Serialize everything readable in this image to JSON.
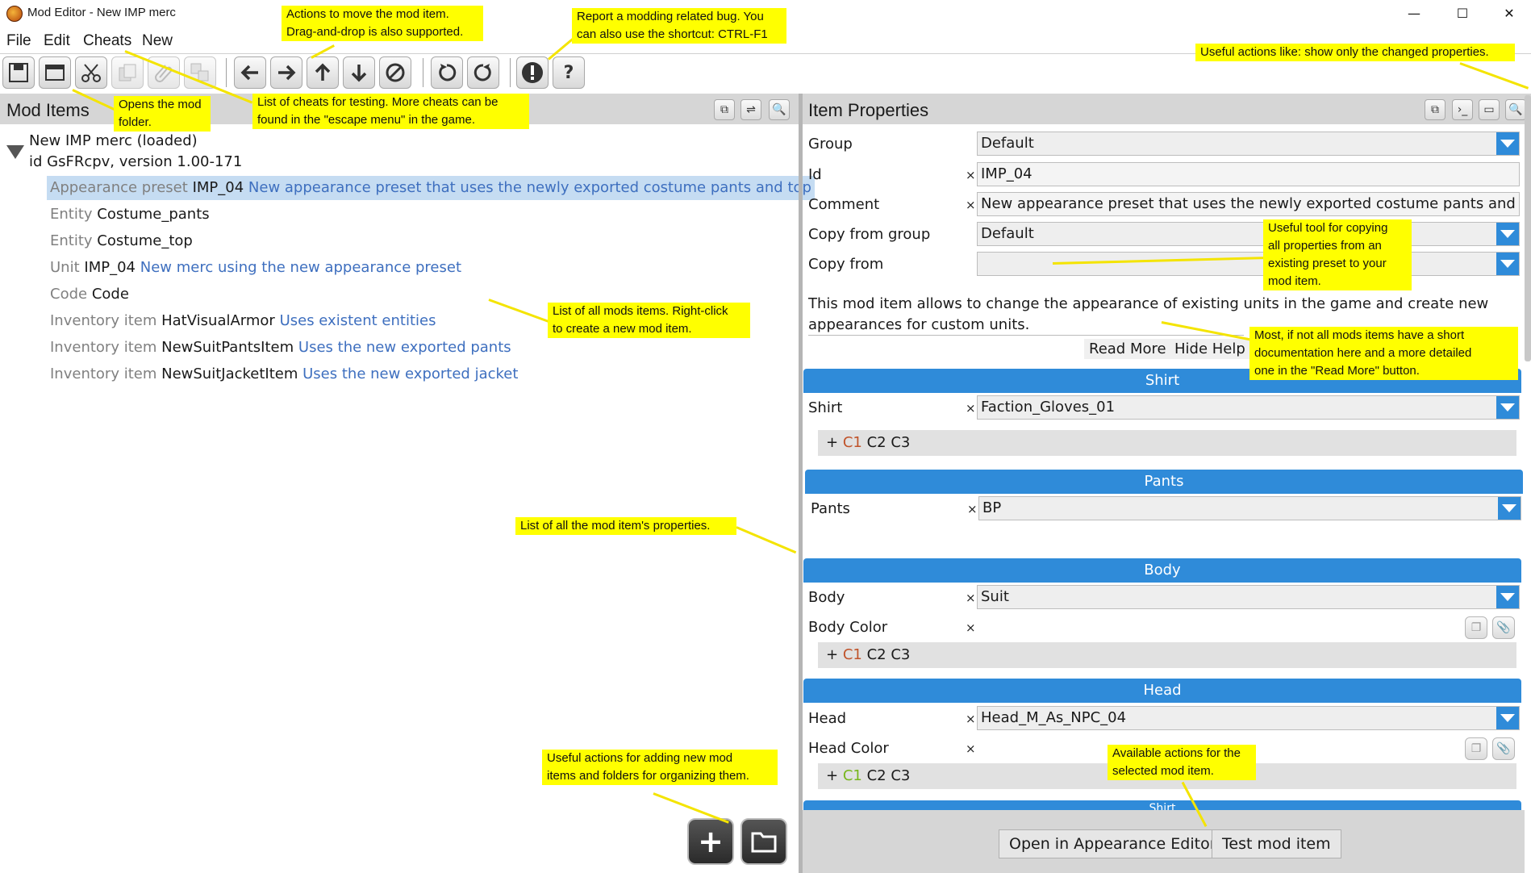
{
  "window": {
    "title": "Mod Editor - New IMP merc",
    "minimize_glyph": "—",
    "maximize_glyph": "☐",
    "close_glyph": "✕"
  },
  "menu": [
    "File",
    "Edit",
    "Cheats",
    "New"
  ],
  "toolbar": {
    "help_glyph": "?",
    "buttons": [
      "save-icon",
      "open-folder-icon",
      "cut-icon",
      "copy-icon",
      "paste-icon",
      "duplicate-icon",
      "arrow-left-icon",
      "arrow-right-icon",
      "arrow-up-icon",
      "arrow-down-icon",
      "cancel-icon",
      "undo-icon",
      "redo-icon",
      "report-bug-icon",
      "help-icon"
    ]
  },
  "left_panel": {
    "title": "Mod Items",
    "mod_name": "New IMP merc (loaded)",
    "mod_id": "id GsFRcpv, version 1.00-171",
    "items": [
      {
        "cls": "Appearance preset",
        "name": "IMP_04",
        "comment": "New appearance preset that uses the newly exported costume pants and top"
      },
      {
        "cls": "Entity",
        "name": "Costume_pants",
        "comment": ""
      },
      {
        "cls": "Entity",
        "name": "Costume_top",
        "comment": ""
      },
      {
        "cls": "Unit",
        "name": "IMP_04",
        "comment": "New merc using the new appearance preset"
      },
      {
        "cls": "Code",
        "name": "Code",
        "comment": ""
      },
      {
        "cls": "Inventory item",
        "name": "HatVisualArmor",
        "comment": "Uses existent entities"
      },
      {
        "cls": "Inventory item",
        "name": "NewSuitPantsItem",
        "comment": "Uses the new exported pants"
      },
      {
        "cls": "Inventory item",
        "name": "NewSuitJacketItem",
        "comment": "Uses the new exported jacket"
      }
    ]
  },
  "right_panel": {
    "title": "Item Properties",
    "clear_glyph": "×",
    "group_label": "Group",
    "group_value": "Default",
    "id_label": "Id",
    "id_value": "IMP_04",
    "comment_label": "Comment",
    "comment_value": "New appearance preset that uses the newly exported costume pants and top",
    "copy_group_label": "Copy from group",
    "copy_group_value": "Default",
    "copy_from_label": "Copy from",
    "copy_from_value": "",
    "help_line1": "This mod item allows to change the appearance of existing units in the game and create new",
    "help_line2": "appearances for custom units.",
    "read_more": "Read More",
    "hide_help": "Hide Help",
    "color_prefix": "+",
    "c1": "C1",
    "c2c3": "C2 C3",
    "sections": {
      "shirt_header": "Shirt",
      "shirt_label": "Shirt",
      "shirt_value": "Faction_Gloves_01",
      "pants_header": "Pants",
      "pants_label": "Pants",
      "pants_value": "BP",
      "body_header": "Body",
      "body_label": "Body",
      "body_value": "Suit",
      "body_color_label": "Body Color",
      "head_header": "Head",
      "head_label": "Head",
      "head_value": "Head_M_As_NPC_04",
      "head_color_label": "Head Color",
      "next_header": "Shirt"
    },
    "open_appearance_editor": "Open in Appearance Editor",
    "test_mod_item": "Test mod item"
  },
  "annotations": {
    "move_actions_1": "Actions to move the mod item.",
    "move_actions_2": "Drag-and-drop is also supported.",
    "report_bug_1": "Report a modding related bug. You",
    "report_bug_2": "can also use the shortcut: CTRL-F1",
    "useful_actions": "Useful actions like: show only the changed properties.",
    "opens_folder_1": "Opens the mod",
    "opens_folder_2": "folder.",
    "cheats_1": "List of cheats for testing. More cheats can be",
    "cheats_2": "found in the \"escape menu\" in the game.",
    "copy_tool_1": "Useful tool for copying",
    "copy_tool_2": "all properties from an",
    "copy_tool_3": "existing preset to your",
    "copy_tool_4": "mod item.",
    "list_items_1": "List of all mods items. Right-click",
    "list_items_2": "to create a new mod item.",
    "docs_1": "Most, if not all mods items have a short",
    "docs_2": "documentation here and a more detailed",
    "docs_3": "one in the \"Read More\" button.",
    "props_list": "List of all the mod item's properties.",
    "add_actions_1": "Useful actions for adding new mod",
    "add_actions_2": "items and folders for organizing them.",
    "available_1": "Available actions for the",
    "available_2": "selected mod item."
  }
}
